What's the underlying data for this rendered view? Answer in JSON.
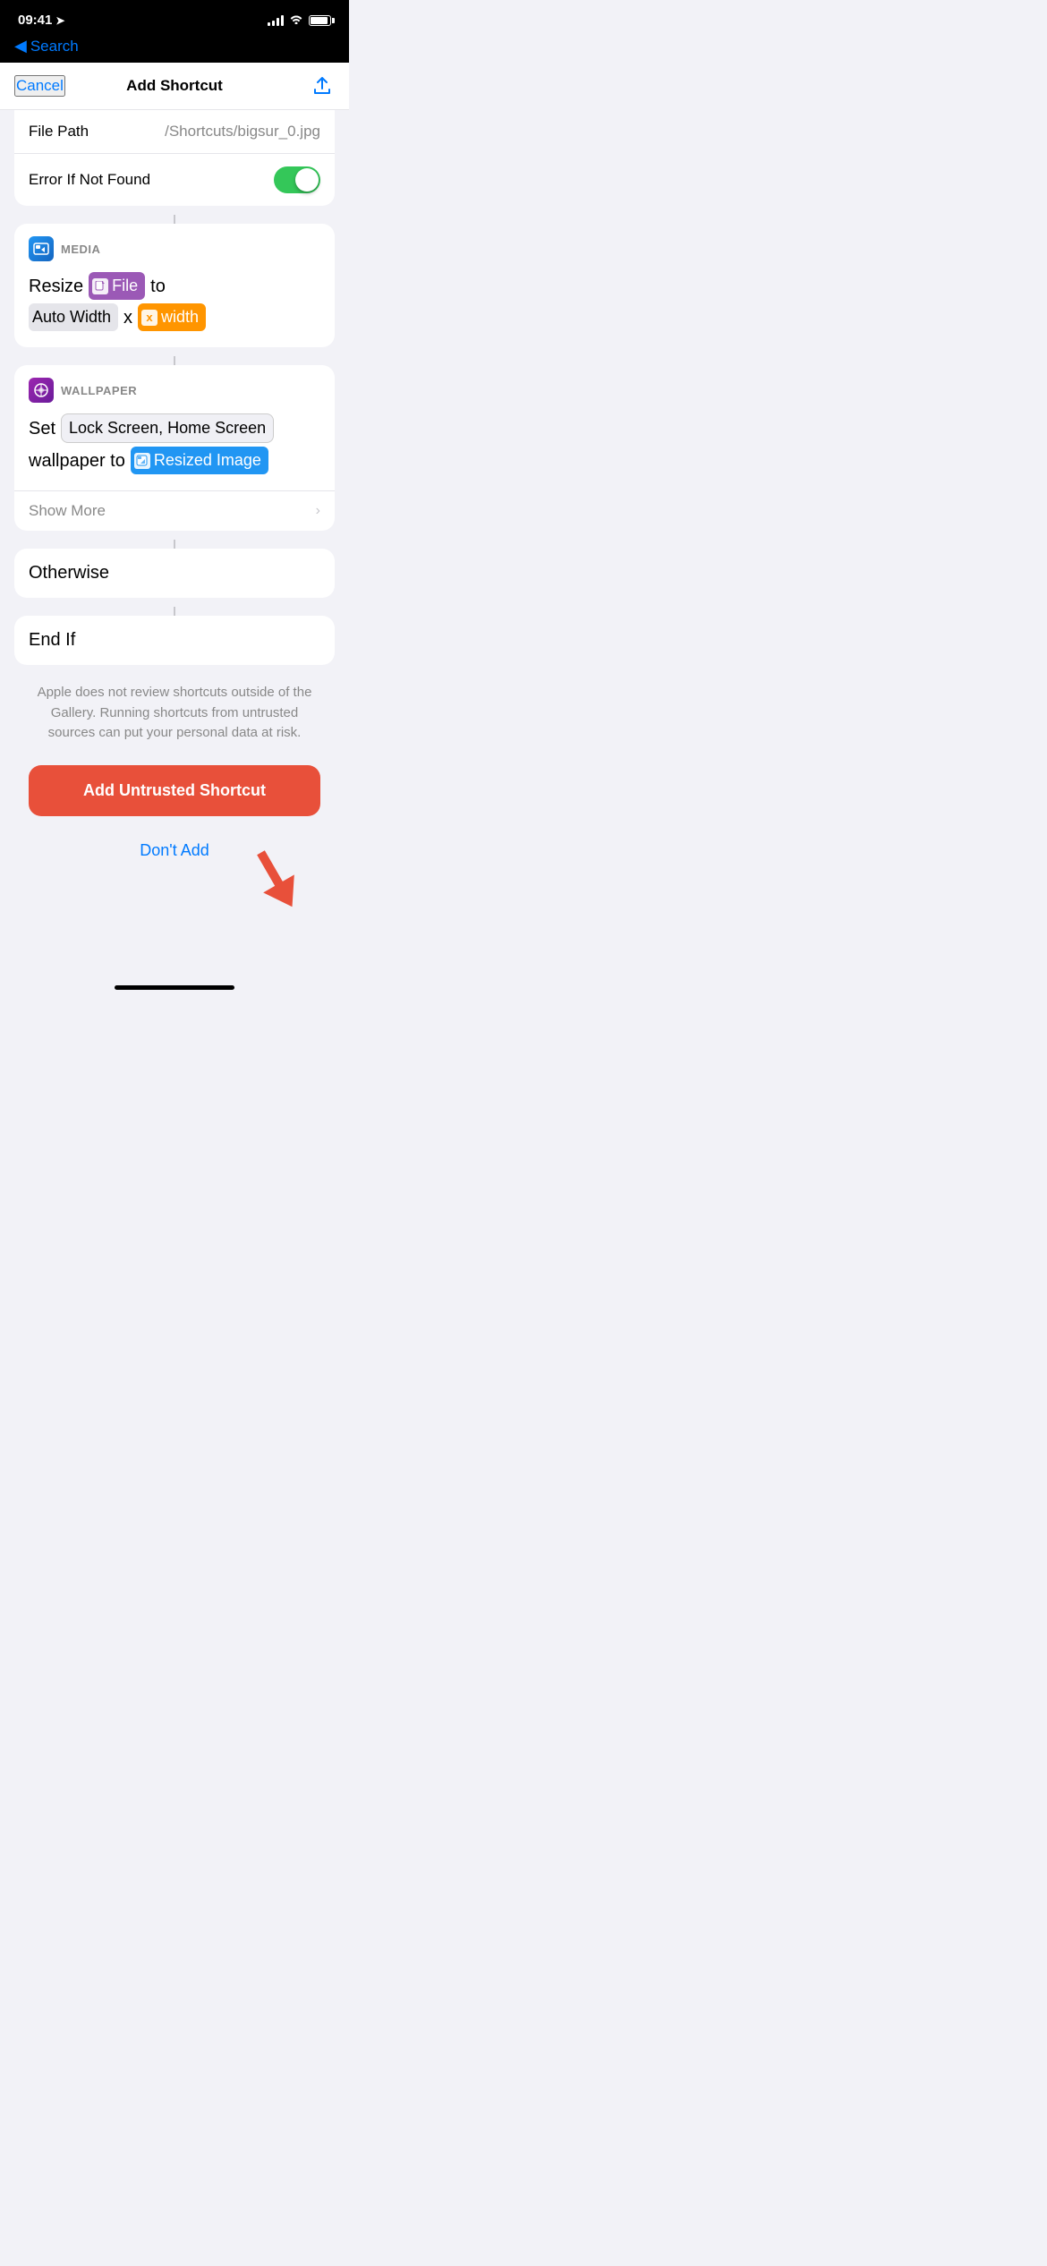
{
  "status_bar": {
    "time": "09:41",
    "back_label": "Search"
  },
  "nav": {
    "cancel_label": "Cancel",
    "title": "Add Shortcut"
  },
  "file_path_card": {
    "label": "File Path",
    "value_prefix": "/Shortcuts/",
    "value_file": "bigsur_0.jpg",
    "error_label": "Error If Not Found"
  },
  "media_card": {
    "section": "MEDIA",
    "action": "Resize",
    "file_token": "File",
    "to_label": "to",
    "width_token": "Auto Width",
    "x_label": "x",
    "x_var": "x",
    "width_label": "width"
  },
  "wallpaper_card": {
    "section": "WALLPAPER",
    "set_label": "Set",
    "screen_token": "Lock Screen, Home Screen",
    "wallpaper_label": "wallpaper to",
    "image_token": "Resized Image",
    "show_more": "Show More"
  },
  "otherwise_card": {
    "label": "Otherwise"
  },
  "end_if_card": {
    "label": "End If"
  },
  "disclaimer": {
    "text": "Apple does not review shortcuts outside of the Gallery. Running shortcuts from untrusted sources can put your personal data at risk."
  },
  "add_button": {
    "label": "Add Untrusted Shortcut"
  },
  "dont_add_button": {
    "label": "Don't Add"
  }
}
